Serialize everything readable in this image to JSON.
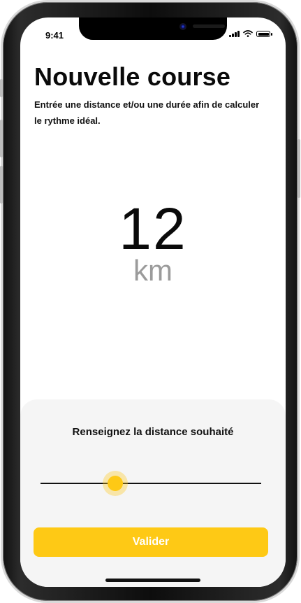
{
  "status_bar": {
    "time": "9:41",
    "icons": [
      "cellular-signal-icon",
      "wifi-icon",
      "battery-icon"
    ]
  },
  "page": {
    "title": "Nouvelle course",
    "subtitle": "Entrée une distance et/ou une durée afin de calculer le rythme idéal."
  },
  "display": {
    "value": "12",
    "unit": "km"
  },
  "sheet": {
    "label": "Renseignez la distance souhaité",
    "slider_fraction": 0.34,
    "button_label": "Valider"
  },
  "colors": {
    "accent": "#fec915",
    "text": "#0a0a0a",
    "muted": "#9b9b9b",
    "sheet_background": "#f5f5f5"
  }
}
